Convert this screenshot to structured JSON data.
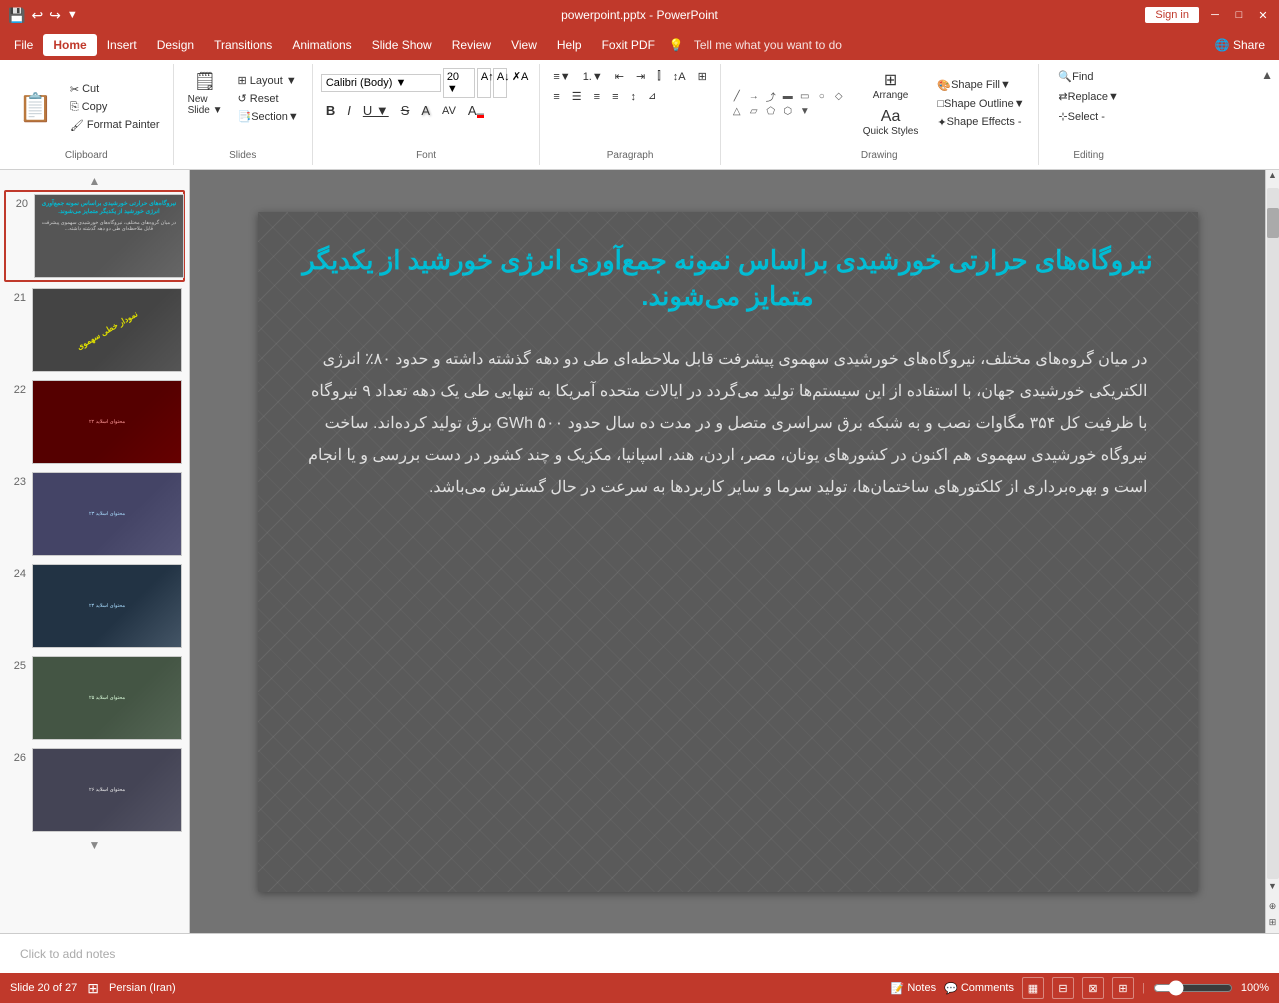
{
  "titleBar": {
    "filename": "powerpoint.pptx - PowerPoint",
    "signInLabel": "Sign in",
    "minimizeIcon": "─",
    "restoreIcon": "□",
    "closeIcon": "✕"
  },
  "menuBar": {
    "items": [
      {
        "id": "file",
        "label": "File"
      },
      {
        "id": "home",
        "label": "Home",
        "active": true
      },
      {
        "id": "insert",
        "label": "Insert"
      },
      {
        "id": "design",
        "label": "Design"
      },
      {
        "id": "transitions",
        "label": "Transitions"
      },
      {
        "id": "animations",
        "label": "Animations"
      },
      {
        "id": "slideshow",
        "label": "Slide Show"
      },
      {
        "id": "review",
        "label": "Review"
      },
      {
        "id": "view",
        "label": "View"
      },
      {
        "id": "help",
        "label": "Help"
      },
      {
        "id": "foxit",
        "label": "Foxit PDF"
      },
      {
        "id": "tellme",
        "label": "Tell me what you want to do"
      }
    ],
    "shareLabel": "Share"
  },
  "ribbon": {
    "clipboard": {
      "label": "Clipboard",
      "paste": "Paste",
      "cut": "Cut",
      "copy": "Copy",
      "formatPainter": "Format Painter"
    },
    "slides": {
      "label": "Slides",
      "newSlide": "New Slide",
      "layout": "Layout",
      "reset": "Reset",
      "section": "Section"
    },
    "font": {
      "label": "Font",
      "fontName": "",
      "fontSize": "",
      "bold": "B",
      "italic": "I",
      "underline": "U",
      "strikethrough": "S",
      "shadow": "A"
    },
    "paragraph": {
      "label": "Paragraph"
    },
    "drawing": {
      "label": "Drawing",
      "arrange": "Arrange",
      "quickStyles": "Quick Styles",
      "shapeFill": "Shape Fill",
      "shapeOutline": "Shape Outline",
      "shapeEffects": "Shape Effects -"
    },
    "editing": {
      "label": "Editing",
      "find": "Find",
      "replace": "Replace",
      "select": "Select -"
    }
  },
  "slides": [
    {
      "number": "20",
      "active": true,
      "thumbClass": "thumb-20",
      "text": "نیروگاه‌های حرارتی خورشیدی"
    },
    {
      "number": "21",
      "active": false,
      "thumbClass": "thumb-21",
      "text": ""
    },
    {
      "number": "22",
      "active": false,
      "thumbClass": "thumb-22",
      "text": ""
    },
    {
      "number": "23",
      "active": false,
      "thumbClass": "thumb-23",
      "text": ""
    },
    {
      "number": "24",
      "active": false,
      "thumbClass": "thumb-24",
      "text": ""
    },
    {
      "number": "25",
      "active": false,
      "thumbClass": "thumb-25",
      "text": ""
    },
    {
      "number": "26",
      "active": false,
      "thumbClass": "thumb-26",
      "text": ""
    }
  ],
  "currentSlide": {
    "title": "نیروگاه‌های حرارتی خورشیدی براساس نمونه جمع‌آوری انرژی خورشید از یکدیگر متمایز می‌شوند.",
    "body": "در میان گروه‌های مختلف، نیروگاه‌های خورشیدی سهموی پیشرفت قابل ملاحظه‌ای طی دو دهه گذشته داشته و حدود ۸۰٪ انرژی الکتریکی خورشیدی جهان، با استفاده از این سیستم‌ها تولید می‌گردد در ایالات متحده آمریکا به تنهایی طی یک دهه تعداد ۹ نیروگاه با ظرفیت کل ۳۵۴ مگاوات نصب و به شبکه برق سراسری متصل و در مدت ده سال حدود ۵۰۰ GWh برق تولید کرده‌اند. ساخت نیروگاه خورشیدی سهموی هم اکنون در کشورهای یونان، مصر، اردن، هند، اسپانیا، مکزیک و چند کشور در دست بررسی و یا انجام است و بهره‌برداری از کلکتورهای ساختمان‌ها، تولید سرما و سایر کاربردها به سرعت در حال گسترش می‌باشد."
  },
  "notesBar": {
    "placeholder": "Click to add notes",
    "notesLabel": "Notes",
    "commentsLabel": "Comments"
  },
  "statusBar": {
    "slideInfo": "Slide 20 of 27",
    "language": "Persian (Iran)",
    "notesLabel": "Notes",
    "commentsLabel": "Comments",
    "zoomLevel": "100%",
    "normalView": "▦",
    "slideView": "▣",
    "readingView": "⊡",
    "presenterView": "⊞"
  }
}
